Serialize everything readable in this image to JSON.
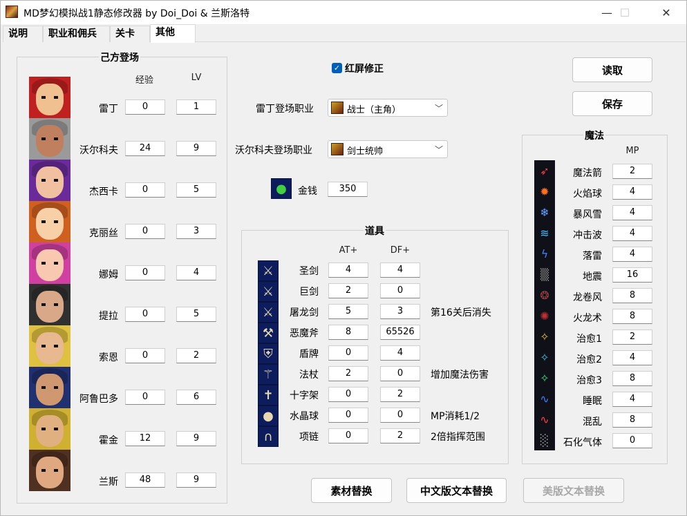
{
  "window": {
    "title": "MD梦幻模拟战1静态修改器 by Doi_Doi & 兰斯洛特",
    "controls": {
      "minimize": "—",
      "maximize": "☐",
      "close": "✕"
    }
  },
  "tabs": [
    {
      "label": "说明"
    },
    {
      "label": "职业和佣兵"
    },
    {
      "label": "关卡"
    },
    {
      "label": "其他"
    }
  ],
  "own_side": {
    "title": "己方登场",
    "header_exp": "经验",
    "header_lv": "LV",
    "rows": [
      {
        "name": "雷丁",
        "exp": "0",
        "lv": "1",
        "hair": "#c02020",
        "skin": "#f0c090"
      },
      {
        "name": "沃尔科夫",
        "exp": "24",
        "lv": "9",
        "hair": "#9a9a9a",
        "skin": "#c08060"
      },
      {
        "name": "杰西卡",
        "exp": "0",
        "lv": "5",
        "hair": "#6a2a9a",
        "skin": "#f0c0a0"
      },
      {
        "name": "克丽丝",
        "exp": "0",
        "lv": "3",
        "hair": "#d06020",
        "skin": "#f8d0a8"
      },
      {
        "name": "娜姆",
        "exp": "0",
        "lv": "4",
        "hair": "#d040a0",
        "skin": "#f8c8b0"
      },
      {
        "name": "提拉",
        "exp": "0",
        "lv": "5",
        "hair": "#303030",
        "skin": "#d8a888"
      },
      {
        "name": "索恩",
        "exp": "0",
        "lv": "2",
        "hair": "#e0c040",
        "skin": "#e8b890"
      },
      {
        "name": "阿鲁巴多",
        "exp": "0",
        "lv": "6",
        "hair": "#203070",
        "skin": "#d09870"
      },
      {
        "name": "霍金",
        "exp": "12",
        "lv": "9",
        "hair": "#d0b030",
        "skin": "#e0b080"
      },
      {
        "name": "兰斯",
        "exp": "48",
        "lv": "9",
        "hair": "#503020",
        "skin": "#e0a880"
      }
    ]
  },
  "red_screen": {
    "label": "红屏修正",
    "checked": true
  },
  "reding_class": {
    "label": "雷丁登场职业",
    "value": "战士（主角）"
  },
  "volkov_class": {
    "label": "沃尔科夫登场职业",
    "value": "剑士统帅"
  },
  "money": {
    "label": "金钱",
    "value": "350"
  },
  "items": {
    "title": "道具",
    "header_at": "AT+",
    "header_df": "DF+",
    "rows": [
      {
        "name": "圣剑",
        "at": "4",
        "df": "4",
        "note": "",
        "icon": "⚔"
      },
      {
        "name": "巨剑",
        "at": "2",
        "df": "0",
        "note": "",
        "icon": "⚔"
      },
      {
        "name": "屠龙剑",
        "at": "5",
        "df": "3",
        "note": "第16关后消失",
        "icon": "⚔"
      },
      {
        "name": "恶魔斧",
        "at": "8",
        "df": "65526",
        "note": "",
        "icon": "⚒"
      },
      {
        "name": "盾牌",
        "at": "0",
        "df": "4",
        "note": "",
        "icon": "⛨"
      },
      {
        "name": "法杖",
        "at": "2",
        "df": "0",
        "note": "增加魔法伤害",
        "icon": "⚚"
      },
      {
        "name": "十字架",
        "at": "0",
        "df": "2",
        "note": "",
        "icon": "✝"
      },
      {
        "name": "水晶球",
        "at": "0",
        "df": "0",
        "note": "MP消耗1/2",
        "icon": "●"
      },
      {
        "name": "项链",
        "at": "0",
        "df": "2",
        "note": "2倍指挥范围",
        "icon": "∩"
      }
    ]
  },
  "magic": {
    "title": "魔法",
    "header_mp": "MP",
    "rows": [
      {
        "name": "魔法箭",
        "mp": "2",
        "icon": "➶",
        "color": "#ff4040"
      },
      {
        "name": "火焰球",
        "mp": "4",
        "icon": "✹",
        "color": "#ff7020"
      },
      {
        "name": "暴风雪",
        "mp": "4",
        "icon": "❄",
        "color": "#60a0ff"
      },
      {
        "name": "冲击波",
        "mp": "4",
        "icon": "≋",
        "color": "#40c0ff"
      },
      {
        "name": "落雷",
        "mp": "4",
        "icon": "ϟ",
        "color": "#4080ff"
      },
      {
        "name": "地震",
        "mp": "16",
        "icon": "▒",
        "color": "#808080"
      },
      {
        "name": "龙卷风",
        "mp": "8",
        "icon": "❂",
        "color": "#a04040"
      },
      {
        "name": "火龙术",
        "mp": "8",
        "icon": "✺",
        "color": "#c03030"
      },
      {
        "name": "治愈1",
        "mp": "2",
        "icon": "✧",
        "color": "#e0c040"
      },
      {
        "name": "治愈2",
        "mp": "4",
        "icon": "✧",
        "color": "#40c0e0"
      },
      {
        "name": "治愈3",
        "mp": "8",
        "icon": "✧",
        "color": "#40e080"
      },
      {
        "name": "睡眠",
        "mp": "4",
        "icon": "∿",
        "color": "#4080ff"
      },
      {
        "name": "混乱",
        "mp": "8",
        "icon": "∿",
        "color": "#ff4040"
      },
      {
        "name": "石化气体",
        "mp": "0",
        "icon": "░",
        "color": "#a0a0a0"
      }
    ]
  },
  "buttons": {
    "read": "读取",
    "save": "保存",
    "asset_replace": "素材替换",
    "cn_text_replace": "中文版文本替换",
    "us_text_replace": "美版文本替换"
  }
}
